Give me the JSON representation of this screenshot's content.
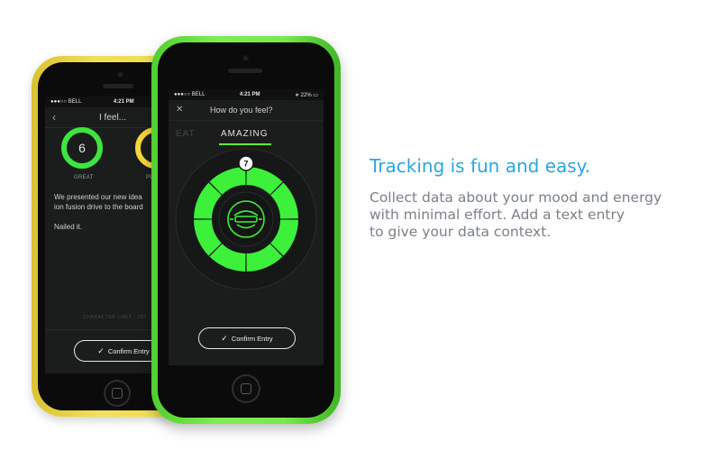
{
  "colors": {
    "accent_blue": "#2aa6e0",
    "body_gray": "#7b8088",
    "ring_green": "#3ee53e",
    "ring_yellow": "#f4d63a",
    "dial_green": "#3df03a"
  },
  "back_phone": {
    "status": {
      "carrier": "●●●○○ BELL",
      "time": "4:21 PM"
    },
    "header": {
      "back_icon": "chevron-left-icon",
      "title": "I feel..."
    },
    "moods": [
      {
        "label": "GREAT",
        "value": "6",
        "color": "#3ee53e"
      },
      {
        "label": "PUMP",
        "color": "#f4d63a"
      }
    ],
    "entry_lines": [
      "We presented our new idea",
      "ion fusion drive to the board"
    ],
    "entry_extra": "Nailed it.",
    "character_limit": "CHARACTER LIMIT : 250",
    "confirm_label": "Confirm Entry"
  },
  "front_phone": {
    "status": {
      "carrier": "●●●○○ BELL",
      "time": "4:21 PM",
      "battery": "22%"
    },
    "header": {
      "close_icon": "close-icon",
      "title": "How do you feel?"
    },
    "tabs": {
      "previous": "EAT",
      "active": "AMAZING"
    },
    "dial": {
      "value": "7",
      "segments": 8,
      "face_icon": "robot-face-icon"
    },
    "confirm_label": "Confirm Entry"
  },
  "feature": {
    "headline": "Tracking is fun and easy.",
    "body_lines": [
      "Collect data about your mood and energy",
      "with minimal effort. Add a text entry",
      "to give your data context."
    ]
  }
}
